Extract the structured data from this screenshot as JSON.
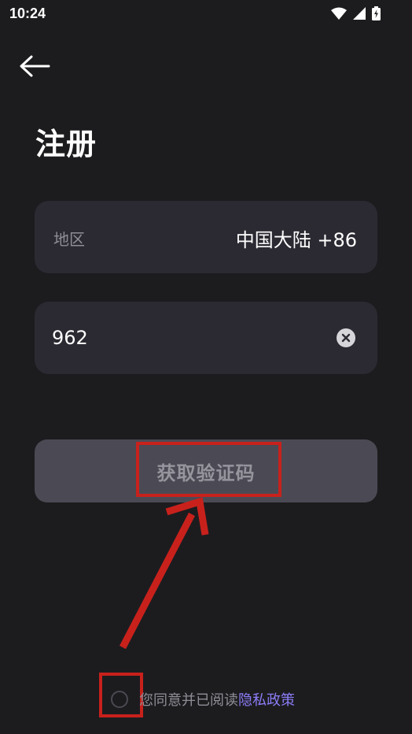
{
  "status_bar": {
    "time": "10:24"
  },
  "header": {
    "title": "注册"
  },
  "region": {
    "label": "地区",
    "value": "中国大陆 +86"
  },
  "phone": {
    "value": "962"
  },
  "actions": {
    "get_code_label": "获取验证码"
  },
  "agreement": {
    "text": "您同意并已阅读",
    "link": "隐私政策"
  },
  "icons": {
    "back": "arrow-left-icon",
    "clear": "close-circle-icon",
    "wifi": "wifi-icon",
    "signal": "signal-icon",
    "battery": "battery-charging-icon"
  },
  "colors": {
    "background": "#1c1c1f",
    "field": "#2b2a32",
    "button": "#4b4a54",
    "link": "#8b7cf6",
    "annotation": "#c8211c"
  }
}
